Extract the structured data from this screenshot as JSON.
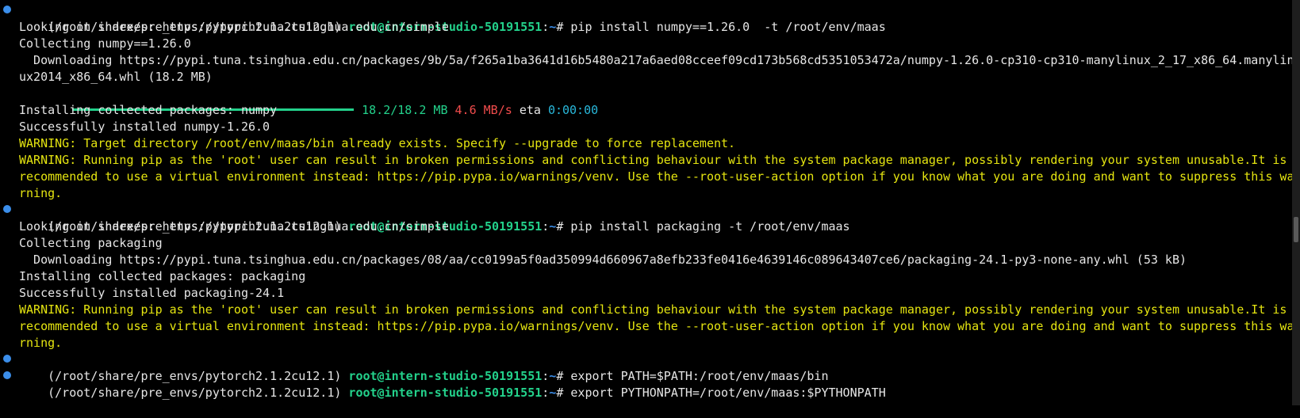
{
  "terminal": {
    "prompt_env": "(/root/share/pre_envs/pytorch2.1.2cu12.1)",
    "prompt_user": "root@intern-studio-50191551",
    "prompt_sep": ":",
    "prompt_path": "~",
    "prompt_symbol": "#",
    "commands": [
      "pip install numpy==1.26.0  -t /root/env/maas",
      "pip install packaging -t /root/env/maas",
      "export PATH=$PATH:/root/env/maas/bin",
      "export PYTHONPATH=/root/env/maas:$PYTHONPATH"
    ],
    "block1": {
      "l1": "Looking in indexes: https://pypi.tuna.tsinghua.edu.cn/simple",
      "l2": "Collecting numpy==1.26.0",
      "l3": "  Downloading https://pypi.tuna.tsinghua.edu.cn/packages/9b/5a/f265a1ba3641d16b5480a217a6aed08cceef09cd173b568cd5351053472a/numpy-1.26.0-cp310-cp310-manylinux_2_17_x86_64.manylin",
      "l4": "ux2014_x86_64.whl (18.2 MB)",
      "progress": {
        "fraction": 1.0,
        "size": "18.2/18.2 MB",
        "speed": "4.6 MB/s",
        "eta_label": "eta",
        "eta": "0:00:00"
      },
      "l5": "Installing collected packages: numpy",
      "l6": "Successfully installed numpy-1.26.0",
      "w1": "WARNING: Target directory /root/env/maas/bin already exists. Specify --upgrade to force replacement.",
      "w2a": "WARNING: Running pip as the 'root' user can result in broken permissions and conflicting behaviour with the system package manager, possibly rendering your system unusable.It is",
      "w2b": "recommended to use a virtual environment instead: https://pip.pypa.io/warnings/venv. Use the --root-user-action option if you know what you are doing and want to suppress this wa",
      "w2c": "rning."
    },
    "block2": {
      "l1": "Looking in indexes: https://pypi.tuna.tsinghua.edu.cn/simple",
      "l2": "Collecting packaging",
      "l3": "  Downloading https://pypi.tuna.tsinghua.edu.cn/packages/08/aa/cc0199a5f0ad350994d660967a8efb233fe0416e4639146c089643407ce6/packaging-24.1-py3-none-any.whl (53 kB)",
      "l4": "Installing collected packages: packaging",
      "l5": "Successfully installed packaging-24.1",
      "w1a": "WARNING: Running pip as the 'root' user can result in broken permissions and conflicting behaviour with the system package manager, possibly rendering your system unusable.It is",
      "w1b": "recommended to use a virtual environment instead: https://pip.pypa.io/warnings/venv. Use the --root-user-action option if you know what you are doing and want to suppress this wa",
      "w1c": "rning."
    }
  },
  "colors": {
    "background": "#000000",
    "prompt_user": "#23d18b",
    "prompt_path": "#3b8eea",
    "warning": "#e5e510",
    "progress_speed": "#f14c4c",
    "progress_eta": "#29b8db"
  }
}
